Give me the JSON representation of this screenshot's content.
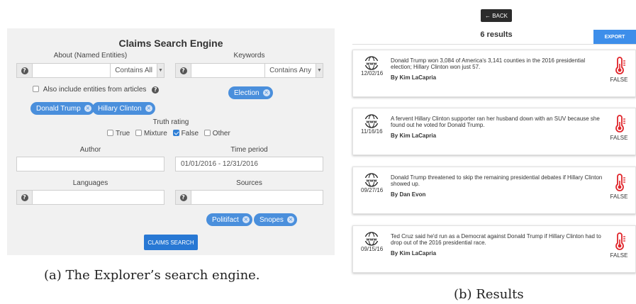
{
  "search": {
    "title": "Claims Search Engine",
    "about_label": "About (Named Entities)",
    "about_mode": "Contains All",
    "keywords_label": "Keywords",
    "keywords_mode": "Contains Any",
    "also_include_label": "Also include entities from articles",
    "keyword_chips": [
      "Election"
    ],
    "entity_chips": [
      "Donald Trump",
      "Hillary Clinton"
    ],
    "truth_rating_label": "Truth rating",
    "truth_options": [
      {
        "label": "True",
        "checked": false
      },
      {
        "label": "Mixture",
        "checked": false
      },
      {
        "label": "False",
        "checked": true
      },
      {
        "label": "Other",
        "checked": false
      }
    ],
    "author_label": "Author",
    "time_period_label": "Time period",
    "time_period_value": "01/01/2016 - 12/31/2016",
    "languages_label": "Languages",
    "sources_label": "Sources",
    "source_chips": [
      "Politifact",
      "Snopes"
    ],
    "button_label": "CLAIMS SEARCH",
    "help_icon": "question-circle-icon",
    "chip_remove_icon": "x-circle-icon"
  },
  "caption_a": "(a) The Explorer’s search engine.",
  "results": {
    "back_label": "← BACK",
    "count_label": "6 results",
    "export_label": "EXPORT",
    "items": [
      {
        "date": "12/02/16",
        "text": "Donald Trump won 3,084 of America's 3,141 counties in the 2016 presidential election; Hillary Clinton won just 57.",
        "author": "By Kim LaCapria",
        "verdict": "FALSE"
      },
      {
        "date": "11/16/16",
        "text": "A fervent Hillary Clinton supporter ran her husband down with an SUV because she found out he voted for Donald Trump.",
        "author": "By Kim LaCapria",
        "verdict": "FALSE"
      },
      {
        "date": "09/27/16",
        "text": "Donald Trump threatened to skip the remaining presidential debates if Hillary Clinton showed up.",
        "author": "By Dan Evon",
        "verdict": "FALSE"
      },
      {
        "date": "09/15/16",
        "text": "Ted Cruz said he'd run as a Democrat against Donald Trump if Hillary Clinton had to drop out of the 2016 presidential race.",
        "author": "By Kim LaCapria",
        "verdict": "FALSE"
      }
    ],
    "source_icon": "www-globe-icon",
    "verdict_icon": "thermometer-icon",
    "verdict_color": "#e0242a"
  },
  "caption_b": "(b) Results"
}
